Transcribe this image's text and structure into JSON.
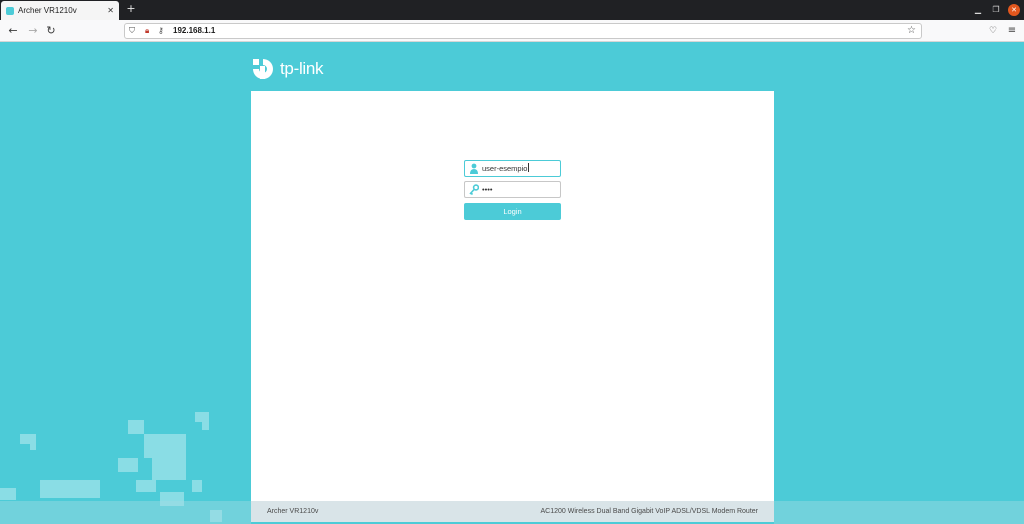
{
  "browser": {
    "tab_title": "Archer VR1210v",
    "tab_close": "✕",
    "new_tab": "+",
    "url": "192.168.1.1",
    "icons": [
      "back-icon",
      "forward-icon",
      "reload-icon",
      "shield-icon",
      "lock-icon",
      "key-icon",
      "star-icon",
      "pocket-icon",
      "menu-icon"
    ]
  },
  "page": {
    "logo_text": "tp-link",
    "username_value": "user-esempio",
    "password_mask": "••••",
    "login_label": "Login",
    "footer_model": "Archer VR1210v",
    "footer_description": "AC1200 Wireless Dual Band Gigabit VoIP ADSL/VDSL Modem Router"
  },
  "colors": {
    "accent": "#4ccbd7",
    "panel": "#ffffff",
    "footer": "#d9e4e8"
  }
}
